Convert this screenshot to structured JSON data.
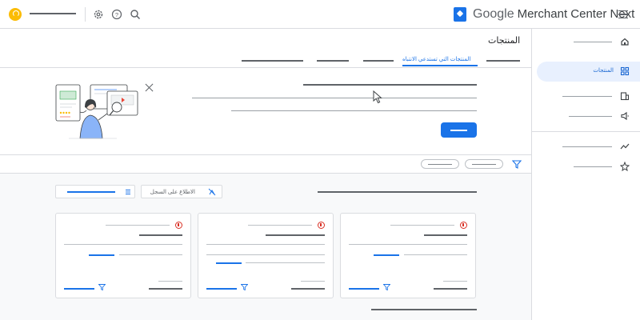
{
  "header": {
    "brand_google": "Google",
    "brand_product": "Merchant Center Next",
    "icons": [
      "account-avatar-icon",
      "settings-gear-icon",
      "help-icon",
      "search-icon",
      "menu-icon"
    ],
    "accent_color": "#1a73e8",
    "avatar_color": "#fbbc04"
  },
  "nav": {
    "items": [
      {
        "icon": "home-icon",
        "label": ""
      },
      {
        "icon": "products-grid-icon",
        "label": "المنتجات",
        "active": true
      },
      {
        "icon": "store-icon",
        "label": ""
      },
      {
        "icon": "campaign-icon",
        "label": ""
      },
      {
        "icon": "trending-icon",
        "label": ""
      },
      {
        "icon": "growth-icon",
        "label": ""
      }
    ]
  },
  "page": {
    "title": "المنتجات",
    "active_tab": "المنتجات التي تستدعي الانتباه"
  },
  "list": {
    "history_button_label": "الاطلاع على السجل"
  },
  "cards": [
    {
      "status_icon": "error-alert-icon",
      "status_color": "#d93025"
    },
    {
      "status_icon": "error-alert-icon",
      "status_color": "#d93025"
    },
    {
      "status_icon": "error-alert-icon",
      "status_color": "#d93025"
    }
  ]
}
